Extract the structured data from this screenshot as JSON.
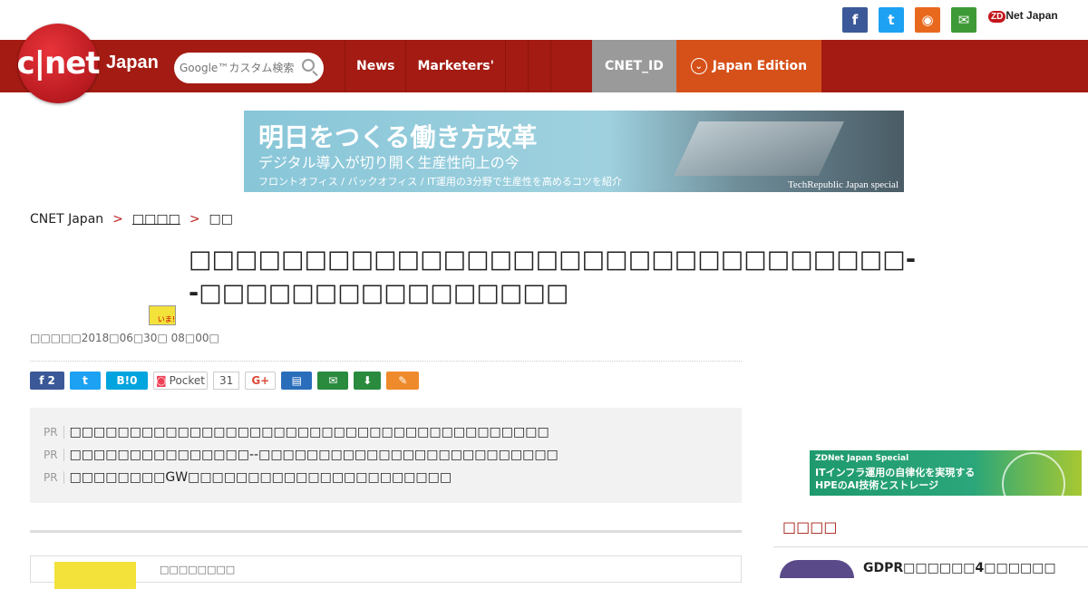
{
  "social": {
    "icons": [
      {
        "name": "facebook-icon",
        "glyph": "f",
        "color": "#3b5998"
      },
      {
        "name": "twitter-icon",
        "glyph": "t",
        "color": "#1da1f2"
      },
      {
        "name": "rss-icon",
        "glyph": "◉",
        "color": "#e8691e"
      },
      {
        "name": "mail-icon",
        "glyph": "✉",
        "color": "#3e9a36"
      }
    ],
    "zdnet_label": "Net Japan",
    "zdnet_mark": "ZD"
  },
  "header": {
    "logo": "c|net",
    "logo_sub": "Japan",
    "search_placeholder": "Google™カスタム検索",
    "nav": [
      "News",
      "Marketers'"
    ],
    "cnetid": "CNET_ID",
    "edition": "Japan Edition"
  },
  "banner": {
    "headline": "明日をつくる働き方改革",
    "subhead": "デジタル導入が切り開く生産性向上の今",
    "detail": "フロントオフィス / バックオフィス / IT運用の3分野で生産性を高めるコツを紹介",
    "sponsor": "TechRepublic Japan special"
  },
  "breadcrumb": {
    "home": "CNET Japan",
    "sep": ">",
    "level1": "□□□□",
    "level2": "□□"
  },
  "article": {
    "title": "□□□□□□□□□□□□□□□□□□□□□□□□□□□□□□□--□□□□□□□□□□□□□□□□",
    "thumb_label": "いま!",
    "date": "□□□□□2018□06□30□ 08□00□"
  },
  "share": {
    "facebook_count": "2",
    "hatena": "B!0",
    "pocket": "Pocket",
    "pocket_count": "31",
    "gplus": "G+"
  },
  "pr": {
    "tag": "PR",
    "items": [
      "□□□□□□□□□□□□□□□□□□□□□□□□□□□□□□□□□□□□□□□□",
      "□□□□□□□□□□□□□□□--□□□□□□□□□□□□□□□□□□□□□□□□□",
      "□□□□□□□□GW□□□□□□□□□□□□□□□□□□□□□□"
    ]
  },
  "card": {
    "text": "□□□□□□□□"
  },
  "sidebar": {
    "ad_kicker": "ZDNet Japan Special",
    "ad_line1": "ITインフラ運用の自律化を実現する",
    "ad_line2": "HPEのAI技術とストレージ",
    "section_title": "□□□□",
    "item_title": "GDPR□□□□□□4□□□□□□"
  }
}
